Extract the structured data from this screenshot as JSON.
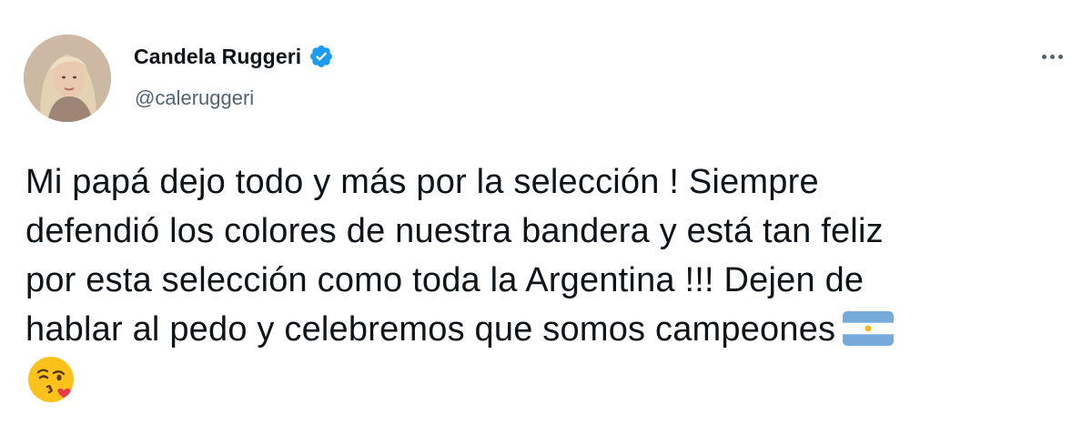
{
  "user": {
    "display_name": "Candela Ruggeri",
    "handle": "@caleruggeri",
    "verified": true,
    "verified_color": "#1d9bf0"
  },
  "tweet": {
    "lines": [
      "Mi papá dejo todo y más por la selección ! Siempre",
      "defendió los colores de nuestra bandera y está tan feliz",
      "por esta selección como toda la Argentina !!! Dejen de",
      "hablar al pedo y celebremos que somos campeones"
    ],
    "emojis": [
      "argentina-flag-icon",
      "face-blowing-kiss-icon"
    ]
  },
  "icons": {
    "more": "more-options-icon",
    "verified": "verified-badge-icon"
  }
}
